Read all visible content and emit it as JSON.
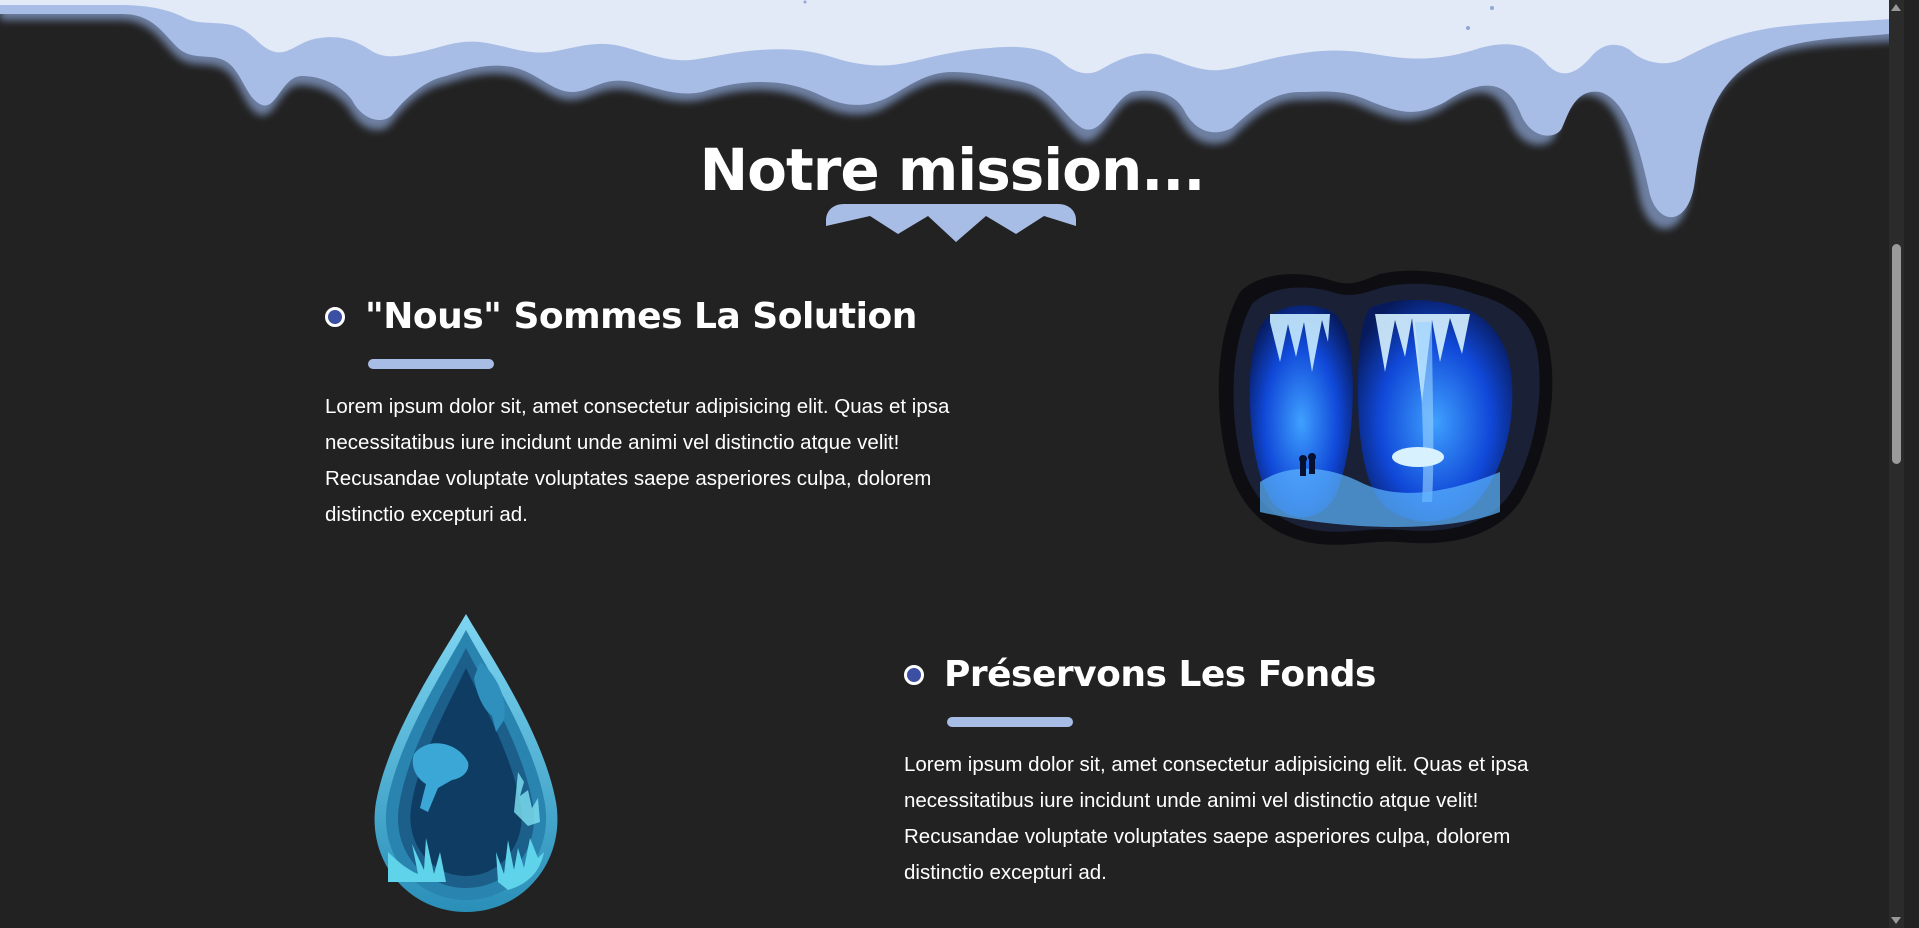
{
  "page": {
    "title": "Notre mission..."
  },
  "missions": [
    {
      "heading": "\"Nous\" Sommes La Solution",
      "body": "Lorem ipsum dolor sit, amet consectetur adipisicing elit. Quas et ipsa necessitatibus iure incidunt unde animi vel distinctio atque velit! Recusandae voluptate voluptates saepe asperiores culpa, dolorem distinctio excepturi ad.",
      "art": "ice-cave-illustration"
    },
    {
      "heading": "Préservons Les Fonds",
      "body": "Lorem ipsum dolor sit, amet consectetur adipisicing elit. Quas et ipsa necessitatibus iure incidunt unde animi vel distinctio atque velit! Recusandae voluptate voluptates saepe asperiores culpa, dolorem distinctio excepturi ad.",
      "art": "water-drop-fish-illustration"
    }
  ],
  "colors": {
    "background": "#222222",
    "snow_light": "#e2e9f7",
    "snow_shadow": "#a8bde6",
    "bullet": "#3b4fa3",
    "accent_bar": "#a8bde6"
  },
  "icons": {
    "bullet": "circle-bullet-icon"
  }
}
